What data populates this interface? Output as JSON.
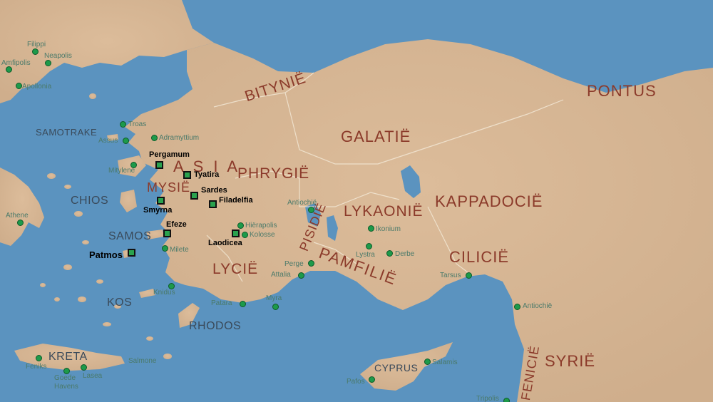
{
  "regions": {
    "bitynie": "BITYNIË",
    "pontus": "PONTUS",
    "galatie": "GALATIË",
    "asia": "A S I A",
    "phrygie": "PHRYGIË",
    "mysie": "MYSIË",
    "lykaonie": "LYKAONIË",
    "kappadocie": "KAPPADOCIË",
    "pisidie": "PISIDIË",
    "pamfilie": "PAMFILIË",
    "cilicie": "CILICIË",
    "lycie": "LYCIË",
    "syrie": "SYRIË",
    "fenicie": "FENICIË"
  },
  "islands": {
    "samotrake": "SAMOTRAKE",
    "chios": "CHIOS",
    "samos": "SAMOS",
    "kos": "KOS",
    "rhodos": "RHODOS",
    "kreta": "KRETA",
    "cyprus": "CYPRUS"
  },
  "cities": {
    "filippi": "Filippi",
    "neapolis": "Neapolis",
    "amfipolis": "Amfipolis",
    "apollonia": "Apollonia",
    "troas": "Troas",
    "assus": "Assus",
    "adramyttium": "Adramyttium",
    "mitylene": "Mitylene",
    "athene": "Athene",
    "antiochie_pisidia": "Antiochië",
    "ikonium": "Ikonium",
    "lystra": "Lystra",
    "derbe": "Derbe",
    "hierapolis": "Hiërapolis",
    "kolosse": "Kolosse",
    "milete": "Milete",
    "perge": "Perge",
    "attalia": "Attalia",
    "knidus": "Knidus",
    "patara": "Patara",
    "myra": "Myra",
    "tarsus": "Tarsus",
    "antiochie_syria": "Antiochië",
    "salamis": "Salamis",
    "pafos": "Pafos",
    "feniks": "Feniks",
    "goede_havens_1": "Goede",
    "goede_havens_2": "Havens",
    "lasea": "Lasea",
    "salmone": "Salmone",
    "tripolis": "Tripolis"
  },
  "churches": {
    "pergamum": "Pergamum",
    "tyatira": "Tyatira",
    "sardes": "Sardes",
    "filadelfia": "Filadelfia",
    "smyrna": "Smyrna",
    "efeze": "Efeze",
    "laodicea": "Laodicea",
    "patmos": "Patmos"
  },
  "colors": {
    "sea": "#5b93bf",
    "land": "#d9b897",
    "region_text": "#8b3a2a",
    "city_dot": "#1d9a4a",
    "church_marker": "#2aa24e"
  }
}
